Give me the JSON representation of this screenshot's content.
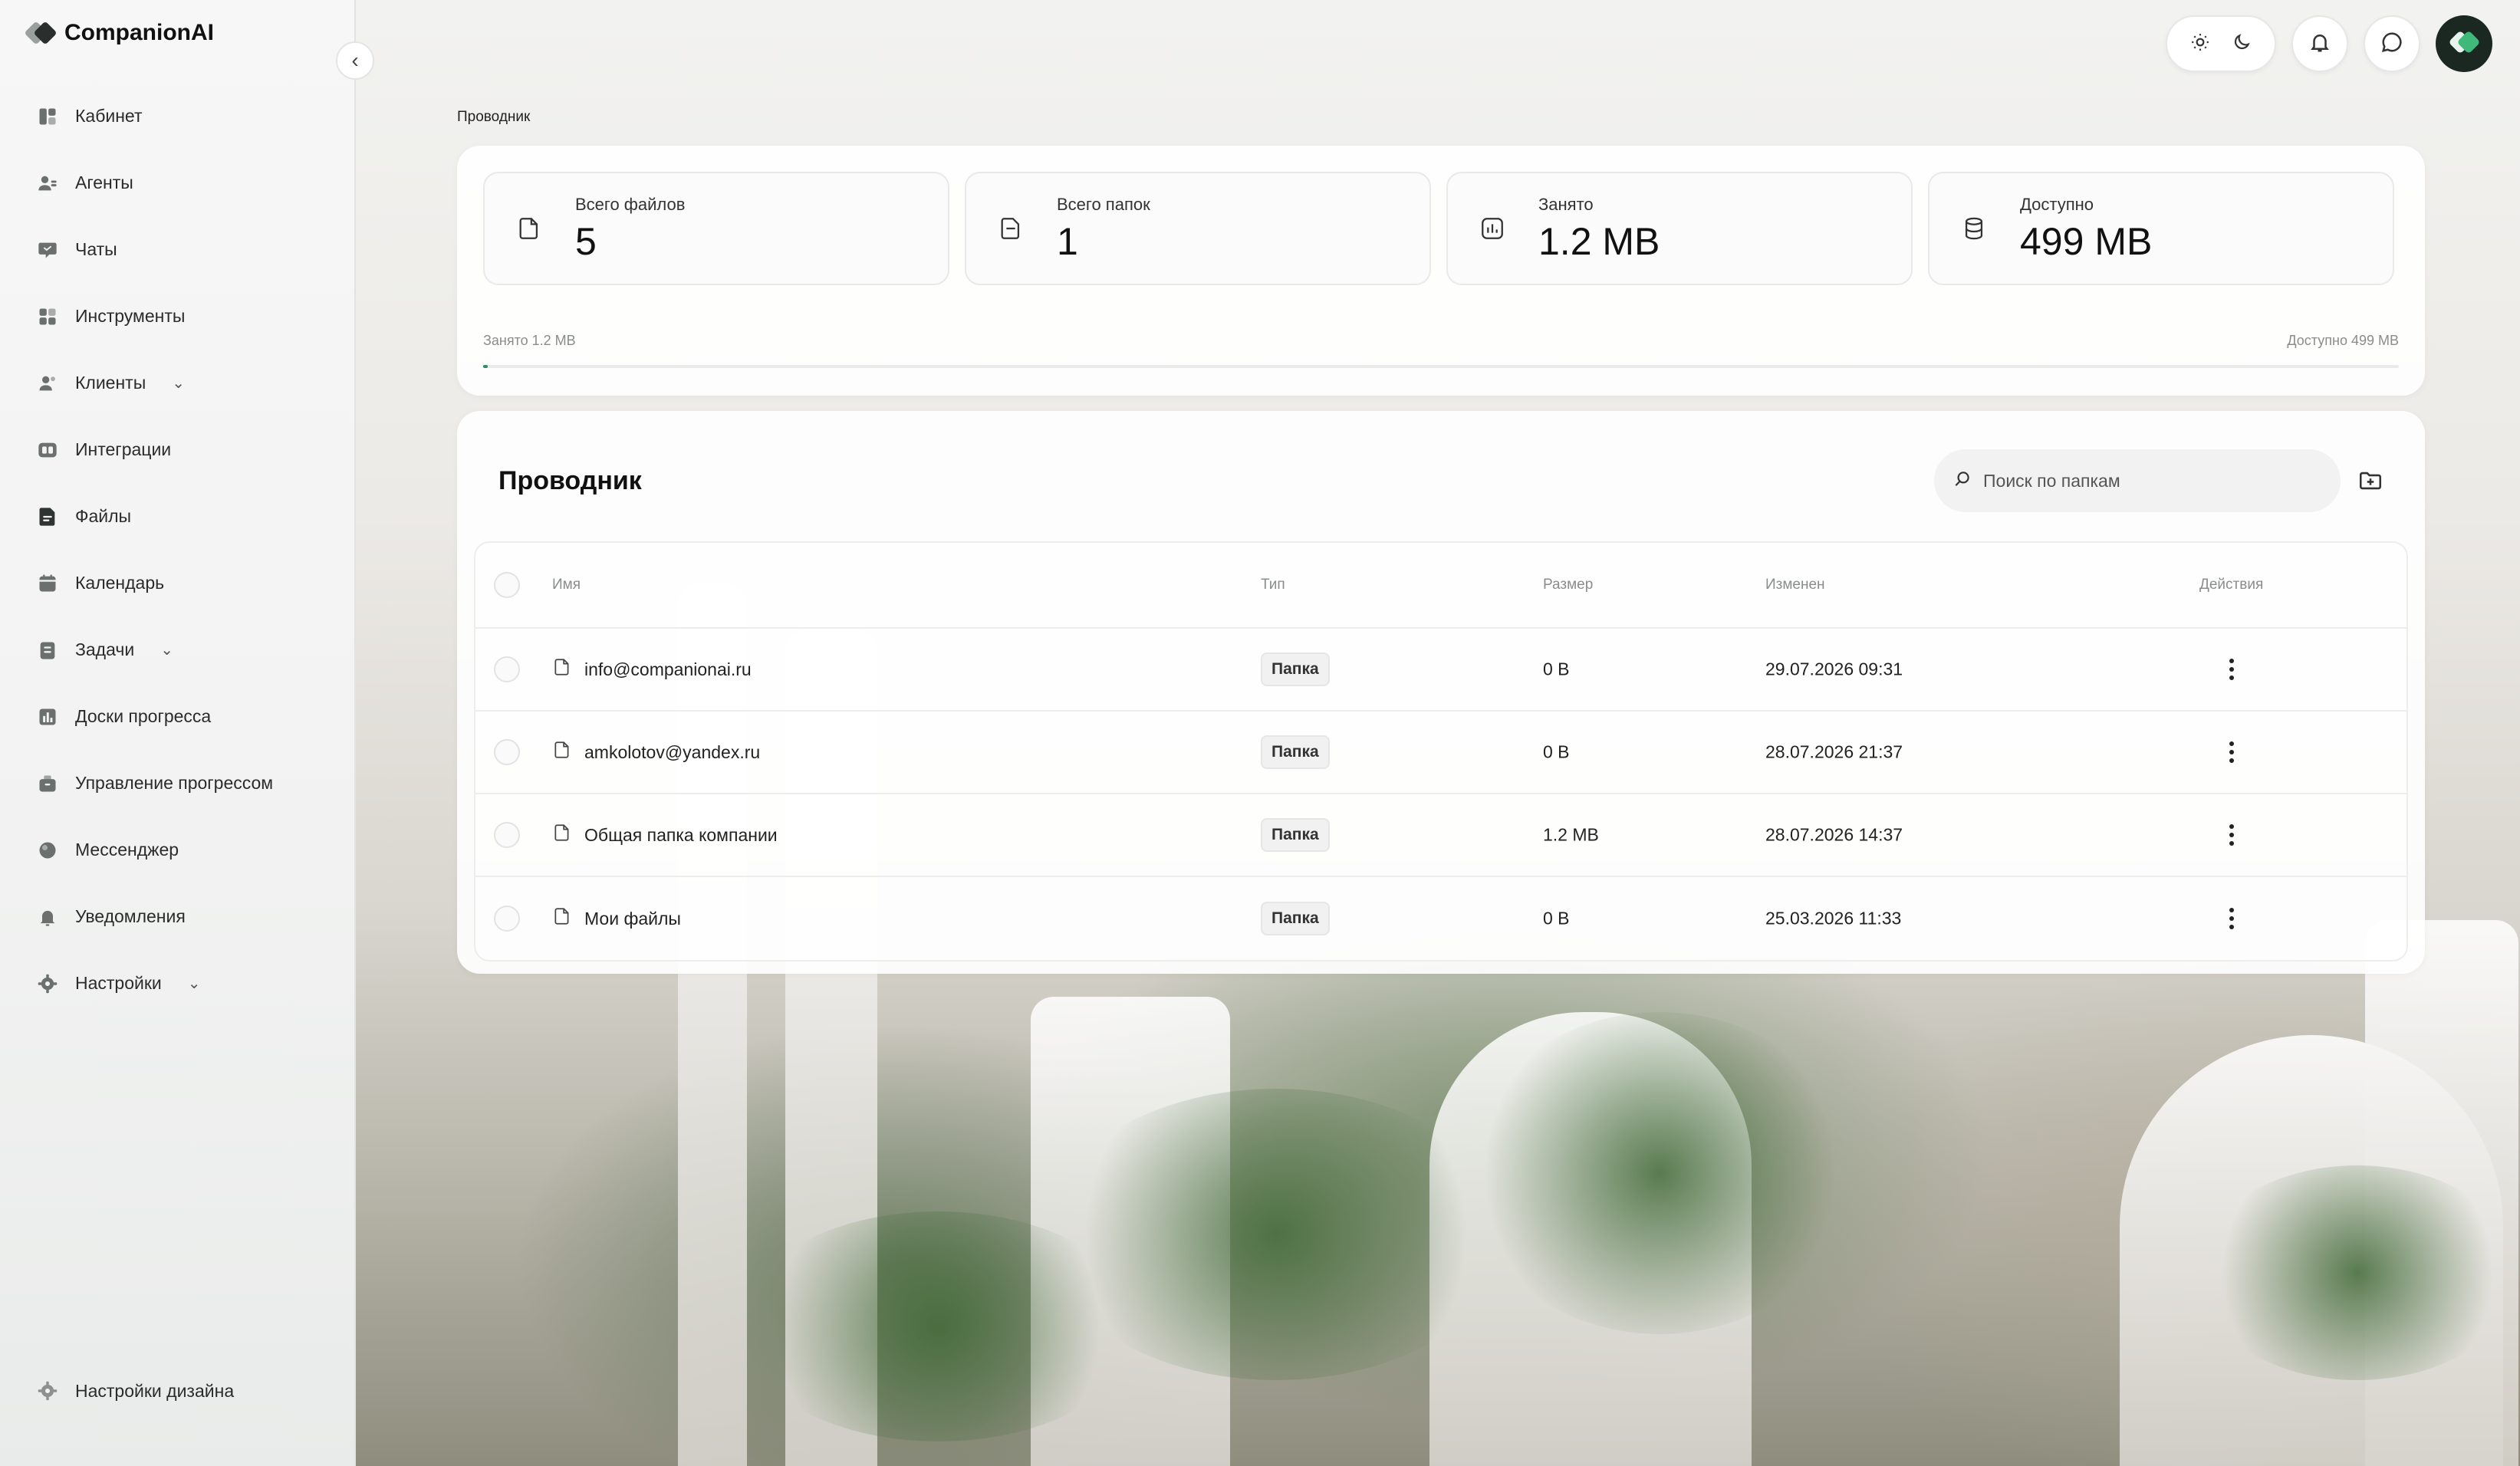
{
  "app": {
    "name": "CompanionAI"
  },
  "sidebar": {
    "items": [
      {
        "label": "Кабинет",
        "icon": "dashboard-icon",
        "has_submenu": false
      },
      {
        "label": "Агенты",
        "icon": "agents-icon",
        "has_submenu": false
      },
      {
        "label": "Чаты",
        "icon": "chat-icon",
        "has_submenu": false
      },
      {
        "label": "Инструменты",
        "icon": "tools-icon",
        "has_submenu": false
      },
      {
        "label": "Клиенты",
        "icon": "clients-icon",
        "has_submenu": true
      },
      {
        "label": "Интеграции",
        "icon": "integrations-icon",
        "has_submenu": false
      },
      {
        "label": "Файлы",
        "icon": "files-icon",
        "has_submenu": false
      },
      {
        "label": "Календарь",
        "icon": "calendar-icon",
        "has_submenu": false
      },
      {
        "label": "Задачи",
        "icon": "tasks-icon",
        "has_submenu": true
      },
      {
        "label": "Доски прогресса",
        "icon": "boards-icon",
        "has_submenu": false
      },
      {
        "label": "Управление прогрессом",
        "icon": "progress-icon",
        "has_submenu": false
      },
      {
        "label": "Мессенджер",
        "icon": "messenger-icon",
        "has_submenu": false
      },
      {
        "label": "Уведомления",
        "icon": "bell-icon",
        "has_submenu": false
      },
      {
        "label": "Настройки",
        "icon": "settings-icon",
        "has_submenu": true
      }
    ],
    "bottom_item": {
      "label": "Настройки дизайна",
      "icon": "gear-icon"
    }
  },
  "breadcrumb": "Проводник",
  "stats": [
    {
      "label": "Всего файлов",
      "value": "5",
      "icon": "file-icon"
    },
    {
      "label": "Всего папок",
      "value": "1",
      "icon": "folder-icon"
    },
    {
      "label": "Занято",
      "value": "1.2 MB",
      "icon": "chart-icon"
    },
    {
      "label": "Доступно",
      "value": "499 MB",
      "icon": "database-icon"
    }
  ],
  "storage": {
    "used_label": "Занято 1.2 MB",
    "available_label": "Доступно 499 MB",
    "used_fraction": 0.0024
  },
  "explorer": {
    "title": "Проводник",
    "search_placeholder": "Поиск по папкам",
    "columns": {
      "name": "Имя",
      "type": "Тип",
      "size": "Размер",
      "modified": "Изменен",
      "actions": "Действия"
    },
    "rows": [
      {
        "name": "info@companionai.ru",
        "type": "Папка",
        "size": "0 B",
        "modified": "29.07.2026 09:31"
      },
      {
        "name": "amkolotov@yandex.ru",
        "type": "Папка",
        "size": "0 B",
        "modified": "28.07.2026 21:37"
      },
      {
        "name": "Общая папка компании",
        "type": "Папка",
        "size": "1.2 MB",
        "modified": "28.07.2026 14:37"
      },
      {
        "name": "Мои файлы",
        "type": "Папка",
        "size": "0 B",
        "modified": "25.03.2026 11:33"
      }
    ]
  },
  "colors": {
    "accent": "#2e8d6d",
    "text": "#1d1d1f",
    "muted": "#8a8d8c",
    "sidebar_icon": "#6b706e"
  }
}
